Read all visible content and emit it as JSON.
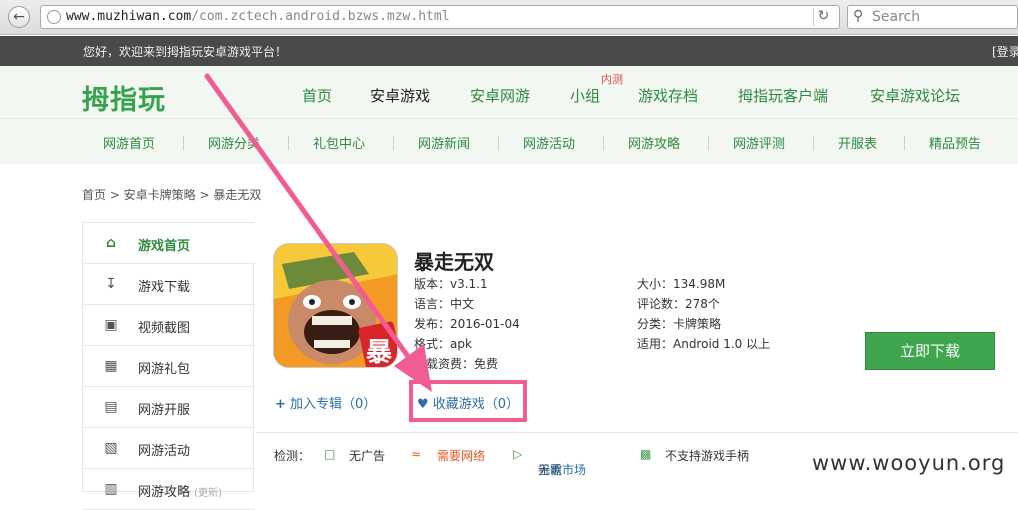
{
  "browser": {
    "url_domain": "www.muzhiwan.com",
    "url_path": "/com.zctech.android.bzws.mzw.html",
    "search_placeholder": "Search"
  },
  "topbar": {
    "welcome": "您好，欢迎来到拇指玩安卓游戏平台！",
    "login": "[登录"
  },
  "header": {
    "logo": "拇指玩",
    "nav": [
      "首页",
      "安卓游戏",
      "安卓网游",
      "小组",
      "游戏存档",
      "拇指玩客户端",
      "安卓游戏论坛"
    ],
    "hot_badge": "内测"
  },
  "subnav": [
    "网游首页",
    "网游分类",
    "礼包中心",
    "网游新闻",
    "网游活动",
    "网游攻略",
    "网游评测",
    "开服表",
    "精品预告"
  ],
  "breadcrumb": "首页 > 安卓卡牌策略 > 暴走无双",
  "sidebar": [
    {
      "label": "游戏首页",
      "icon": "home-icon"
    },
    {
      "label": "游戏下载",
      "icon": "download-icon"
    },
    {
      "label": "视频截图",
      "icon": "image-icon"
    },
    {
      "label": "网游礼包",
      "icon": "gift-icon"
    },
    {
      "label": "网游开服",
      "icon": "list-icon"
    },
    {
      "label": "网游活动",
      "icon": "calendar-icon"
    },
    {
      "label": "网游攻略",
      "sub": "(更新)",
      "icon": "book-icon"
    }
  ],
  "game": {
    "title": "暴走无双",
    "icon_char": "暴",
    "version": "版本：v3.1.1",
    "language": "语言：中文",
    "release": "发布：2016-01-04",
    "format": "格式：apk",
    "fee": "下载资费：免费",
    "size": "大小：134.98M",
    "reviews": "评论数：278个",
    "category": "分类：卡牌策略",
    "requirement": "适用：Android 1.0 以上",
    "download_label": "立即下载",
    "add_album": "加入专辑（0）",
    "favorite": "收藏游戏（0）"
  },
  "check": {
    "label": "检测：",
    "no_ads": "无广告",
    "needs_network": "需要网络",
    "no_google": "无需",
    "google_market": "谷歌市场",
    "no_gamepad": "不支持游戏手柄"
  },
  "watermark": "www.wooyun.org",
  "colors": {
    "green": "#2e8a3e",
    "button": "#3fa54e",
    "highlight": "#f15d92",
    "topbar": "#4a4a4a"
  }
}
